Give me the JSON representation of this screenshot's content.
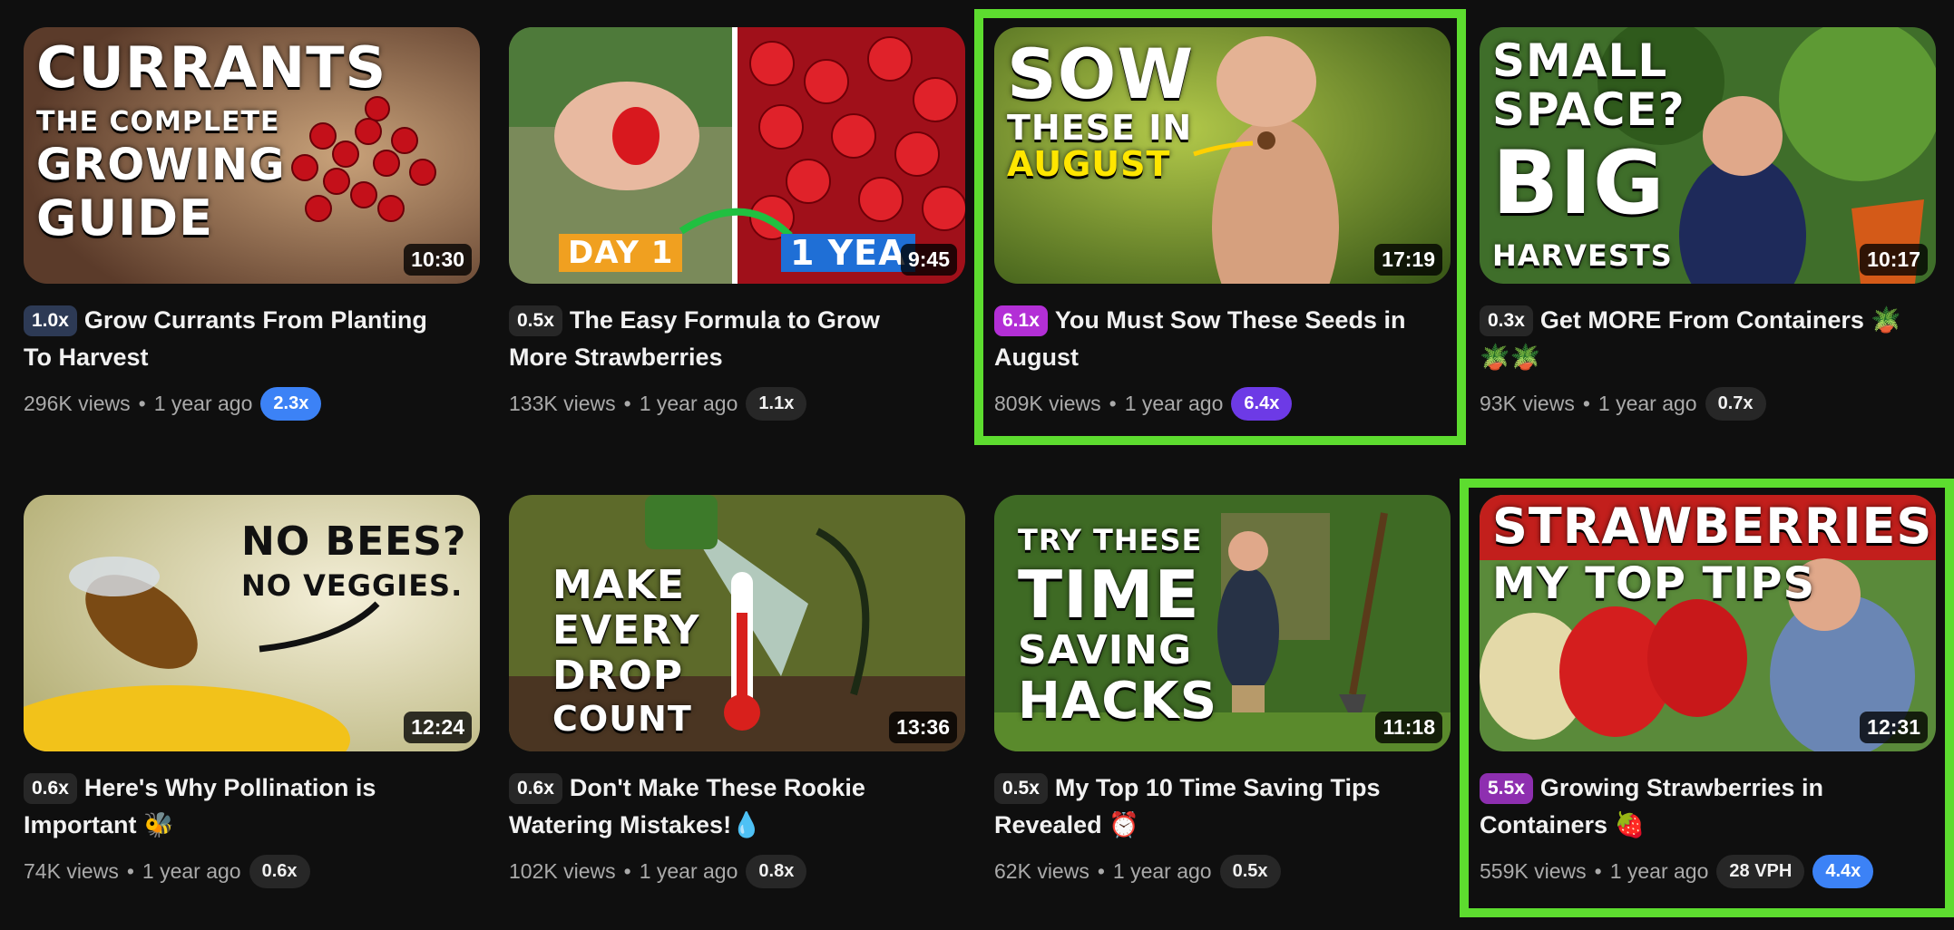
{
  "colors": {
    "background": "#0f0f0f",
    "highlight": "#5ddc2f",
    "pill_blue": "#3c82f6",
    "pill_violet": "#6d3ae6"
  },
  "videos": [
    {
      "thumb_text": [
        "CURRANTS",
        "THE COMPLETE",
        "GROWING",
        "GUIDE"
      ],
      "duration": "10:30",
      "badge": "1.0x",
      "badge_color": "#2d3a55",
      "title": "Grow Currants From Planting To Harvest",
      "views": "296K views",
      "age": "1 year ago",
      "pills": [
        {
          "label": "2.3x",
          "style": "blue"
        }
      ],
      "highlighted": false
    },
    {
      "thumb_text": [
        "DAY 1",
        "1 YEA"
      ],
      "duration": "9:45",
      "badge": "0.5x",
      "badge_color": "#272727",
      "title": "The Easy Formula to Grow More Strawberries",
      "views": "133K views",
      "age": "1 year ago",
      "pills": [
        {
          "label": "1.1x",
          "style": "gray"
        }
      ],
      "highlighted": false
    },
    {
      "thumb_text": [
        "SOW",
        "THESE IN",
        "AUGUST"
      ],
      "duration": "17:19",
      "badge": "6.1x",
      "badge_color": "#b32fd6",
      "title": "You Must Sow These Seeds in August",
      "views": "809K views",
      "age": "1 year ago",
      "pills": [
        {
          "label": "6.4x",
          "style": "violet"
        }
      ],
      "highlighted": true
    },
    {
      "thumb_text": [
        "SMALL",
        "SPACE?",
        "BIG",
        "HARVESTS"
      ],
      "duration": "10:17",
      "badge": "0.3x",
      "badge_color": "#272727",
      "title": "Get MORE From Containers 🪴🪴🪴",
      "views": "93K views",
      "age": "1 year ago",
      "pills": [
        {
          "label": "0.7x",
          "style": "gray"
        }
      ],
      "highlighted": false
    },
    {
      "thumb_text": [
        "NO BEES?",
        "NO VEGGIES."
      ],
      "duration": "12:24",
      "badge": "0.6x",
      "badge_color": "#272727",
      "title": "Here's Why Pollination is Important 🐝",
      "views": "74K views",
      "age": "1 year ago",
      "pills": [
        {
          "label": "0.6x",
          "style": "gray"
        }
      ],
      "highlighted": false
    },
    {
      "thumb_text": [
        "MAKE",
        "EVERY",
        "DROP",
        "COUNT"
      ],
      "duration": "13:36",
      "badge": "0.6x",
      "badge_color": "#272727",
      "title": "Don't Make These Rookie Watering Mistakes!💧",
      "views": "102K views",
      "age": "1 year ago",
      "pills": [
        {
          "label": "0.8x",
          "style": "gray"
        }
      ],
      "highlighted": false
    },
    {
      "thumb_text": [
        "TRY THESE",
        "TIME",
        "SAVING",
        "HACKS"
      ],
      "duration": "11:18",
      "badge": "0.5x",
      "badge_color": "#272727",
      "title": "My Top 10 Time Saving Tips Revealed ⏰",
      "views": "62K views",
      "age": "1 year ago",
      "pills": [
        {
          "label": "0.5x",
          "style": "gray"
        }
      ],
      "highlighted": false
    },
    {
      "thumb_text": [
        "STRAWBERRIES",
        "MY TOP TIPS"
      ],
      "duration": "12:31",
      "badge": "5.5x",
      "badge_color": "#8e2fb0",
      "title": "Growing Strawberries in Containers 🍓",
      "views": "559K views",
      "age": "1 year ago",
      "pills": [
        {
          "label": "28 VPH",
          "style": "gray"
        },
        {
          "label": "4.4x",
          "style": "blue"
        }
      ],
      "highlighted": true
    }
  ]
}
